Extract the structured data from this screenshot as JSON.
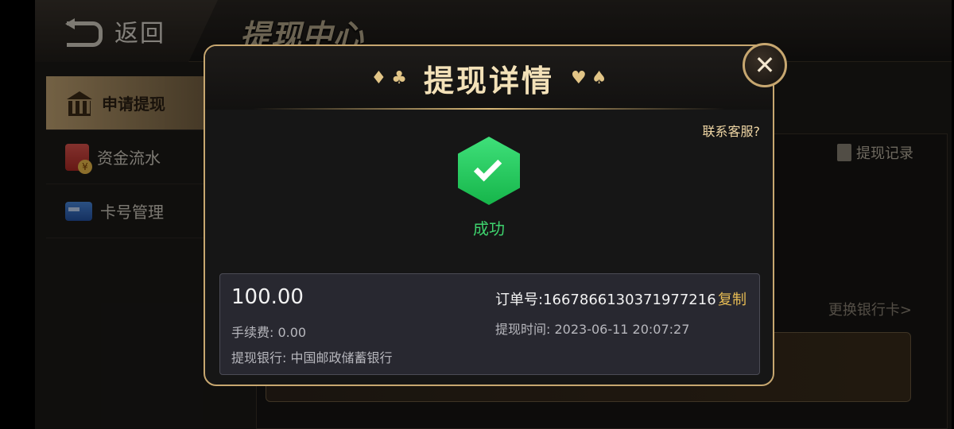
{
  "header": {
    "back_label": "返回",
    "page_title": "提现中心"
  },
  "sidebar": {
    "items": [
      {
        "label": "申请提现",
        "icon": "bank-icon",
        "active": true
      },
      {
        "label": "资金流水",
        "icon": "fund-icon",
        "active": false
      },
      {
        "label": "卡号管理",
        "icon": "card-icon",
        "active": false
      }
    ]
  },
  "main": {
    "record_link": "提现记录",
    "change_bank": "更换银行卡>"
  },
  "modal": {
    "title": "提现详情",
    "contact": "联系客服?",
    "status": "成功",
    "amount": "100.00",
    "fee": "手续费: 0.00",
    "bank": "提现银行: 中国邮政储蓄银行",
    "order": "订单号:1667866130371977216",
    "copy": "复制",
    "time": "提现时间:  2023-06-11 20:07:27",
    "close_icon": "close-icon",
    "suits": [
      "♦",
      "♣",
      "♥",
      "♠"
    ]
  },
  "colors": {
    "accent_gold": "#c7a770",
    "success_green": "#3ed26d",
    "copy_yellow": "#e6bb54"
  }
}
